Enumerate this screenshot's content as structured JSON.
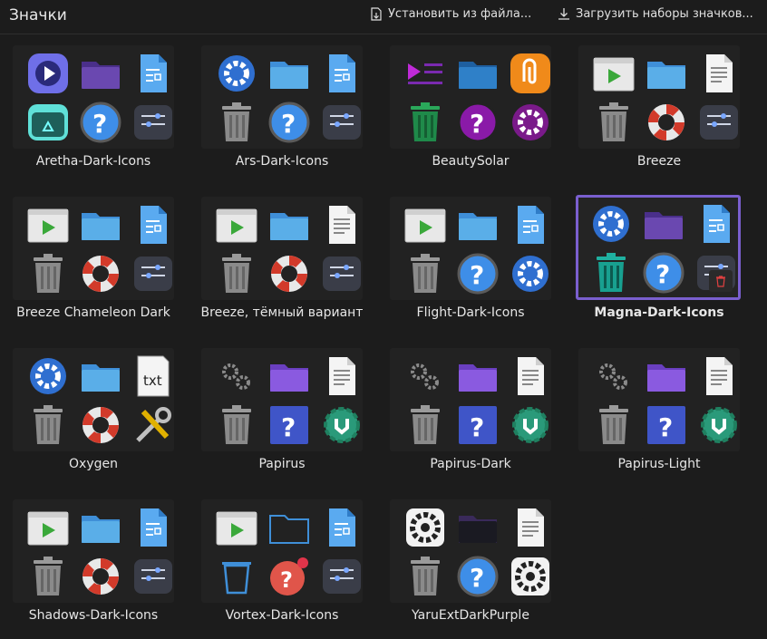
{
  "header": {
    "title": "Значки",
    "install_label": "Установить из файла...",
    "download_label": "Загрузить наборы значков..."
  },
  "themes": [
    {
      "name": "Aretha-Dark-Icons",
      "icons": [
        "media-player-icon",
        "folder-icon",
        "document-icon",
        "recycle-bin-icon",
        "help-icon",
        "settings-sliders-icon"
      ]
    },
    {
      "name": "Ars-Dark-Icons",
      "icons": [
        "gear-icon",
        "folder-icon",
        "document-icon",
        "trash-icon",
        "help-icon",
        "settings-sliders-icon"
      ]
    },
    {
      "name": "BeautySolar",
      "icons": [
        "playlist-icon",
        "folder-icon",
        "paperclip-icon",
        "trash-icon",
        "help-icon",
        "gear-icon"
      ]
    },
    {
      "name": "Breeze",
      "icons": [
        "media-window-icon",
        "folder-icon",
        "text-document-icon",
        "trash-icon",
        "lifebuoy-icon",
        "settings-sliders-icon"
      ]
    },
    {
      "name": "Breeze Chameleon Dark",
      "icons": [
        "media-window-icon",
        "folder-icon",
        "document-icon",
        "trash-icon",
        "lifebuoy-icon",
        "settings-sliders-icon"
      ]
    },
    {
      "name": "Breeze, тёмный вариант",
      "icons": [
        "media-window-icon",
        "folder-icon",
        "text-document-icon",
        "trash-icon",
        "lifebuoy-icon",
        "settings-sliders-icon"
      ]
    },
    {
      "name": "Flight-Dark-Icons",
      "icons": [
        "media-window-icon",
        "folder-icon",
        "document-icon",
        "trash-icon",
        "help-icon",
        "gear-icon"
      ]
    },
    {
      "name": "Magna-Dark-Icons",
      "icons": [
        "gear-icon",
        "folder-icon",
        "document-icon",
        "trash-icon",
        "help-icon",
        "settings-sliders-icon"
      ],
      "selected": true
    },
    {
      "name": "Oxygen",
      "icons": [
        "gear-icon",
        "folder-icon",
        "txt-document-icon",
        "trash-icon",
        "lifebuoy-icon",
        "tools-icon"
      ]
    },
    {
      "name": "Papirus",
      "icons": [
        "gears-icon",
        "folder-icon",
        "text-document-icon",
        "trash-icon",
        "help-icon",
        "wrench-gear-icon"
      ]
    },
    {
      "name": "Papirus-Dark",
      "icons": [
        "gears-icon",
        "folder-icon",
        "text-document-icon",
        "trash-icon",
        "help-icon",
        "wrench-gear-icon"
      ]
    },
    {
      "name": "Papirus-Light",
      "icons": [
        "gears-icon",
        "folder-icon",
        "text-document-icon",
        "trash-icon",
        "help-icon",
        "wrench-gear-icon"
      ]
    },
    {
      "name": "Shadows-Dark-Icons",
      "icons": [
        "media-window-icon",
        "folder-icon",
        "document-icon",
        "trash-icon",
        "lifebuoy-icon",
        "settings-sliders-icon"
      ]
    },
    {
      "name": "Vortex-Dark-Icons",
      "icons": [
        "media-window-icon",
        "folder-icon",
        "document-icon",
        "trash-icon",
        "help-icon",
        "settings-sliders-icon"
      ]
    },
    {
      "name": "YaruExtDarkPurple",
      "icons": [
        "gear-icon",
        "folder-icon",
        "text-document-icon",
        "trash-icon",
        "help-icon",
        "gear-icon"
      ]
    }
  ],
  "colors": {
    "selection": "#7a5fcf",
    "background": "#1c1c1c",
    "tile": "#222222"
  }
}
